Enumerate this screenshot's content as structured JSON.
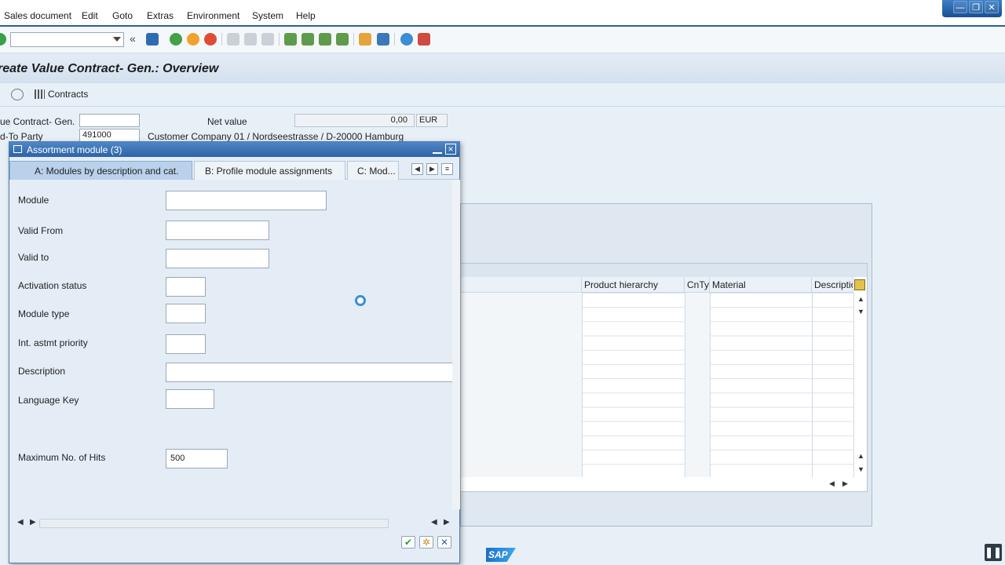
{
  "menubar": {
    "items": [
      "Sales document",
      "Edit",
      "Goto",
      "Extras",
      "Environment",
      "System",
      "Help"
    ]
  },
  "window_controls": {
    "minimize": "—",
    "restore": "❐",
    "close": "✕"
  },
  "toolbar": {
    "command_field_value": ""
  },
  "page": {
    "title": "reate Value Contract- Gen.: Overview",
    "contracts_button": "Contracts"
  },
  "header": {
    "doc_label": "ue Contract- Gen.",
    "doc_value": "",
    "net_value_label": "Net value",
    "net_value": "0,00",
    "currency": "EUR",
    "sold_to_label": "d-To Party",
    "sold_to_value": "491000",
    "customer_text": "Customer Company 01 / Nordseestrasse / D-20000 Hamburg"
  },
  "bg_table": {
    "columns": [
      "Product hierarchy",
      "CnTy",
      "Material",
      "Descriptio"
    ]
  },
  "dialog": {
    "title": "Assortment module (3)",
    "tabs": [
      "A: Modules by description and cat.",
      "B: Profile module assignments",
      "C: Mod..."
    ],
    "fields": {
      "module": {
        "label": "Module",
        "value": ""
      },
      "valid_from": {
        "label": "Valid From",
        "value": ""
      },
      "valid_to": {
        "label": "Valid to",
        "value": ""
      },
      "activation_status": {
        "label": "Activation status",
        "value": ""
      },
      "module_type": {
        "label": "Module type",
        "value": ""
      },
      "int_astmt_priority": {
        "label": "Int. astmt priority",
        "value": ""
      },
      "description": {
        "label": "Description",
        "value": ""
      },
      "language_key": {
        "label": "Language Key",
        "value": ""
      },
      "max_hits": {
        "label": "Maximum No. of Hits",
        "value": "500"
      }
    }
  },
  "footer": {
    "logo_text": "SAP"
  },
  "colors": {
    "accent": "#2b5f98",
    "dialog_title": "#2d64a6",
    "active_tab": "#b9d1ea"
  }
}
